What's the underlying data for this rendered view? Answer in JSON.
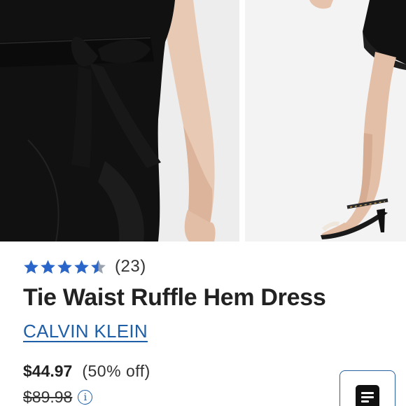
{
  "gallery": {
    "images": [
      {
        "icon": "dress-waist-tie-photo"
      },
      {
        "icon": "dress-hem-heels-photo"
      }
    ]
  },
  "rating": {
    "stars_value": 4.5,
    "stars_max": 5,
    "star_color": "#2a66c9",
    "count_text": "(23)"
  },
  "product": {
    "title": "Tie Waist Ruffle Hem Dress",
    "brand": "CALVIN KLEIN",
    "brand_color": "#1f5fa8"
  },
  "price": {
    "sale": "$44.97",
    "discount": "(50% off)",
    "original": "$89.98",
    "info_icon_glyph": "i"
  },
  "fab": {
    "icon": "menu-lines-icon"
  }
}
